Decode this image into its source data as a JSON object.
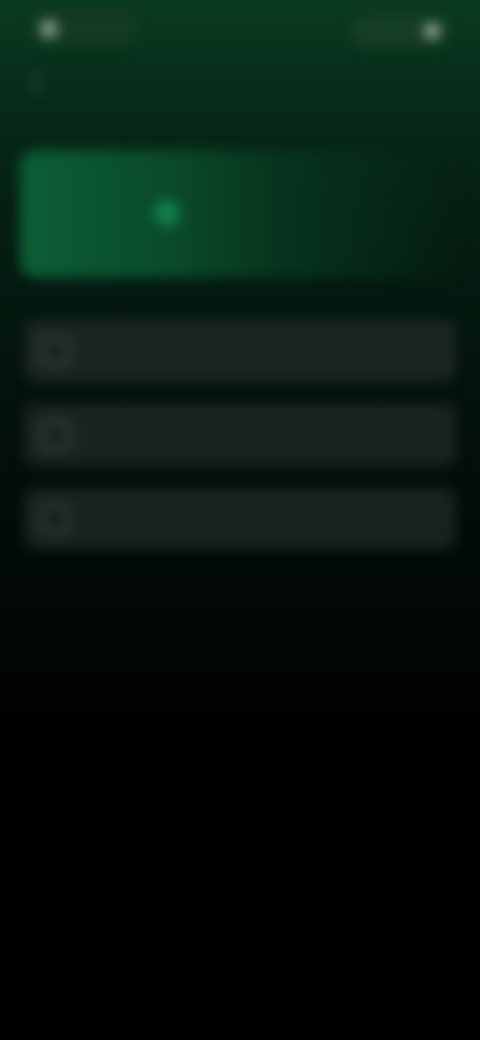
{
  "header": {
    "app_label": "",
    "status_label": "",
    "title": ""
  },
  "hero": {
    "badge_label": ""
  },
  "list": {
    "items": [
      {
        "label": "",
        "icon": "square-icon"
      },
      {
        "label": "",
        "icon": "square-icon"
      },
      {
        "label": "",
        "icon": "square-icon"
      }
    ]
  },
  "colors": {
    "accent_green": "#0b5e36",
    "badge_green": "#128a52",
    "background_top": "#0a3a22",
    "background_bottom": "#000000",
    "card_surface": "#282e2b"
  }
}
